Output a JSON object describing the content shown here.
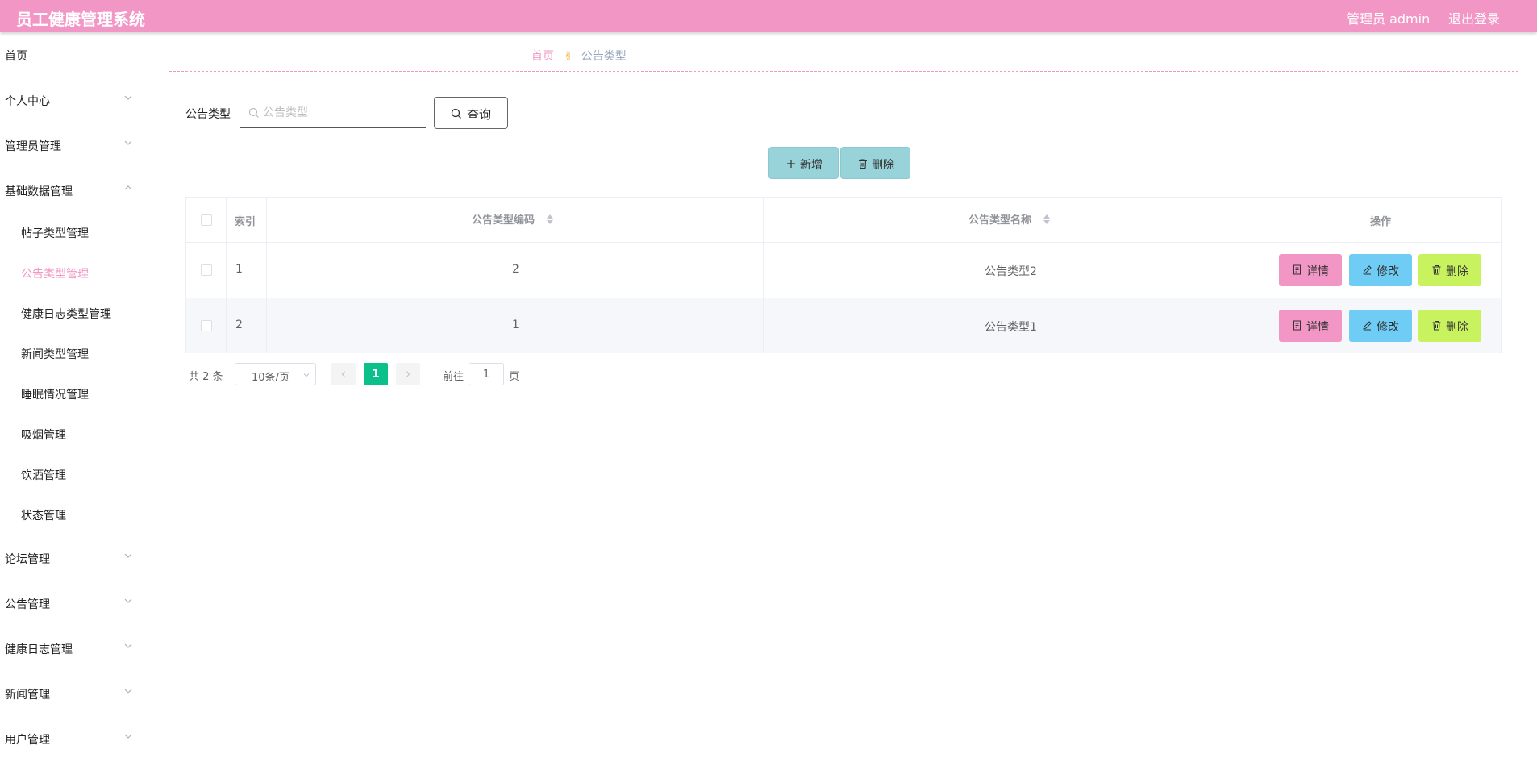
{
  "app": {
    "title": "员工健康管理系统",
    "user": "管理员 admin",
    "logout": "退出登录"
  },
  "sidebar": {
    "home": "首页",
    "groups": [
      {
        "label": "个人中心",
        "expanded": false
      },
      {
        "label": "管理员管理",
        "expanded": false
      },
      {
        "label": "基础数据管理",
        "expanded": true,
        "children": [
          "帖子类型管理",
          "公告类型管理",
          "健康日志类型管理",
          "新闻类型管理",
          "睡眠情况管理",
          "吸烟管理",
          "饮酒管理",
          "状态管理"
        ],
        "active_child": "公告类型管理"
      },
      {
        "label": "论坛管理",
        "expanded": false
      },
      {
        "label": "公告管理",
        "expanded": false
      },
      {
        "label": "健康日志管理",
        "expanded": false
      },
      {
        "label": "新闻管理",
        "expanded": false
      },
      {
        "label": "用户管理",
        "expanded": false
      }
    ]
  },
  "breadcrumb": {
    "home": "首页",
    "current": "公告类型"
  },
  "search": {
    "label": "公告类型",
    "placeholder": "公告类型",
    "value": "",
    "button": "查询"
  },
  "toolbar": {
    "add": "新增",
    "delete": "删除"
  },
  "table": {
    "columns": [
      "索引",
      "公告类型编码",
      "公告类型名称",
      "操作"
    ],
    "rows": [
      {
        "index": "1",
        "code": "2",
        "name": "公告类型2"
      },
      {
        "index": "2",
        "code": "1",
        "name": "公告类型1"
      }
    ],
    "actions": {
      "detail": "详情",
      "edit": "修改",
      "delete": "删除"
    }
  },
  "pagination": {
    "total": "共 2 条",
    "page_size": "10条/页",
    "current_page": "1",
    "goto_label": "前往",
    "goto_value": "1",
    "goto_unit": "页"
  },
  "colors": {
    "header": "#f196c5",
    "toolbar_button": "#97d3d9",
    "detail": "#f196c5",
    "edit": "#6fcdf5",
    "delete": "#c9f25f",
    "page_active": "#0bc08a"
  }
}
